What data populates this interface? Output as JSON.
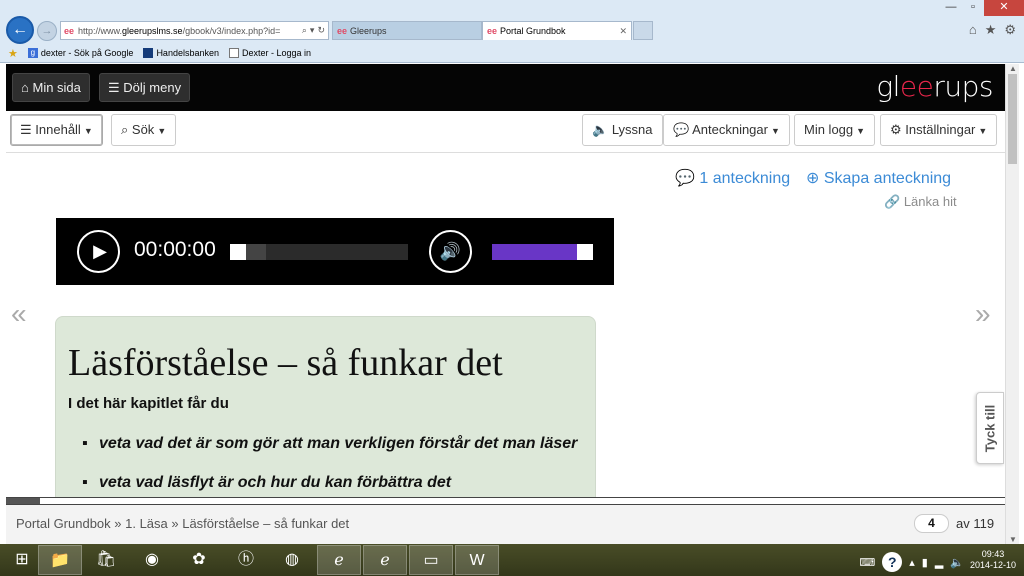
{
  "browser": {
    "url_prefix": "http://www.",
    "url_domain": "gleerupslms.se",
    "url_rest": "/gbook/v3/index.php?id=",
    "favicon": "ee",
    "tabs": [
      {
        "label": "Gleerups",
        "active": false
      },
      {
        "label": "Portal Grundbok",
        "active": true
      }
    ],
    "favorites": [
      {
        "label": "dexter - Sök på Google",
        "icon": "google-icon"
      },
      {
        "label": "Handelsbanken",
        "icon": "handelsbanken-icon"
      },
      {
        "label": "Dexter - Logga in",
        "icon": "page-icon"
      }
    ]
  },
  "topbar": {
    "min_sida": "Min sida",
    "dolj_meny": "Dölj meny",
    "logo_pre": "gl",
    "logo_accent": "ee",
    "logo_post": "rups"
  },
  "toolbar": {
    "innehall": "Innehåll",
    "sok": "Sök",
    "lyssna": "Lyssna",
    "anteckningar": "Anteckningar",
    "min_logg": "Min logg",
    "installningar": "Inställningar"
  },
  "notes": {
    "count_label": "1 anteckning",
    "create_label": "Skapa anteckning",
    "link_label": "Länka hit"
  },
  "player": {
    "time": "00:00:00",
    "progress": 0.0,
    "buffered": 0.2,
    "volume": 0.85
  },
  "content": {
    "title": "Läsförståelse – så funkar det",
    "subtitle": "I det här kapitlet får du",
    "bullets": [
      "veta vad det är som gör att man verkligen förstår det man läser",
      "veta vad läsflyt är och hur du kan förbättra det"
    ]
  },
  "feedback": {
    "label": "Tyck till"
  },
  "footer": {
    "breadcrumb": "Portal Grundbok » 1. Läsa » Läsförståelse – så funkar det",
    "page": "4",
    "of_total": "av 119",
    "book_progress": 0.034
  },
  "taskbar": {
    "apps": [
      "windows-start-icon",
      "file-explorer-icon",
      "store-icon",
      "media-icon",
      "paint-icon",
      "hp-icon",
      "firefox-icon",
      "internet-explorer-icon",
      "internet-explorer-2-icon",
      "photos-icon",
      "word-icon"
    ],
    "time": "09:43",
    "date": "2014-12-10"
  }
}
